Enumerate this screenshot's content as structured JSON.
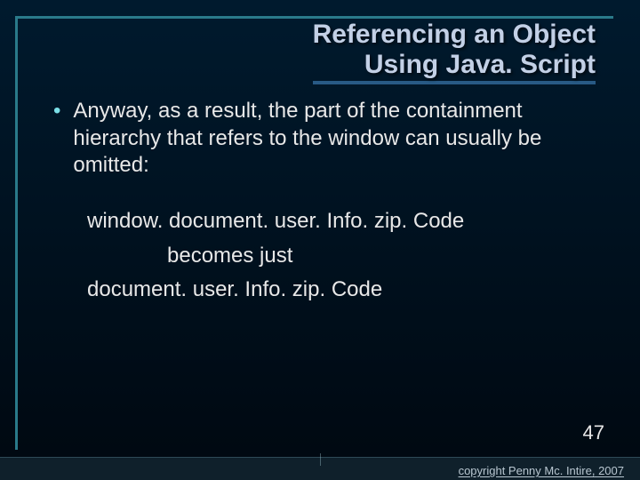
{
  "title": {
    "line1": "Referencing an Object",
    "line2": "Using Java. Script"
  },
  "bullet1": "Anyway, as a result, the part of the containment hierarchy that refers to the window can usually be omitted:",
  "code": {
    "line1": "window. document. user. Info. zip. Code",
    "line2": "becomes just",
    "line3": "document. user. Info. zip. Code"
  },
  "page_number": "47",
  "copyright": "copyright Penny Mc. Intire, 2007"
}
